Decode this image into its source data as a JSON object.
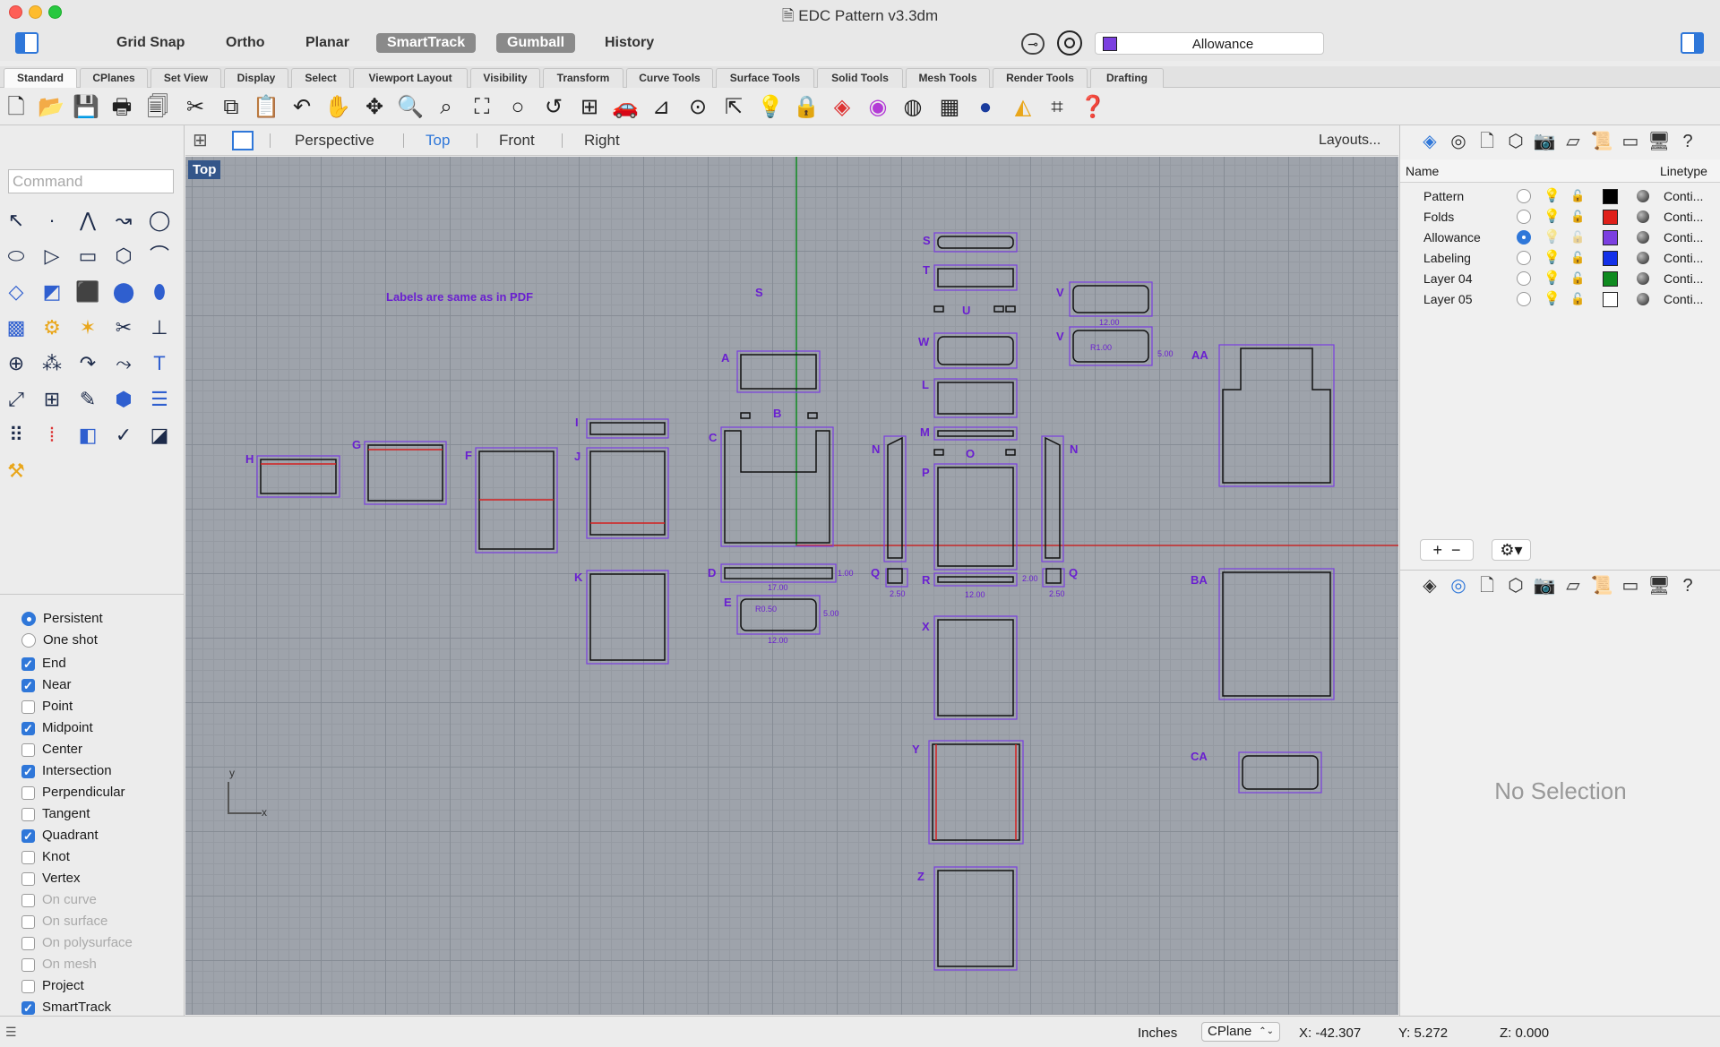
{
  "window": {
    "title": "EDC Pattern v3.3dm"
  },
  "toolbar": {
    "grid_snap": "Grid Snap",
    "ortho": "Ortho",
    "planar": "Planar",
    "smarttrack": "SmartTrack",
    "gumball": "Gumball",
    "history": "History",
    "current_layer": "Allowance",
    "current_layer_color": "#7b3fe0"
  },
  "tabs": [
    "Standard",
    "CPlanes",
    "Set View",
    "Display",
    "Select",
    "Viewport Layout",
    "Visibility",
    "Transform",
    "Curve Tools",
    "Surface Tools",
    "Solid Tools",
    "Mesh Tools",
    "Render Tools",
    "Drafting"
  ],
  "command": {
    "placeholder": "Command"
  },
  "osnap": {
    "modes": [
      "Persistent",
      "One shot"
    ],
    "snaps": [
      {
        "label": "End",
        "checked": true
      },
      {
        "label": "Near",
        "checked": true
      },
      {
        "label": "Point",
        "checked": false
      },
      {
        "label": "Midpoint",
        "checked": true
      },
      {
        "label": "Center",
        "checked": false
      },
      {
        "label": "Intersection",
        "checked": true
      },
      {
        "label": "Perpendicular",
        "checked": false
      },
      {
        "label": "Tangent",
        "checked": false
      },
      {
        "label": "Quadrant",
        "checked": true
      },
      {
        "label": "Knot",
        "checked": false
      },
      {
        "label": "Vertex",
        "checked": false
      },
      {
        "label": "On curve",
        "checked": false,
        "disabled": true
      },
      {
        "label": "On surface",
        "checked": false,
        "disabled": true
      },
      {
        "label": "On polysurface",
        "checked": false,
        "disabled": true
      },
      {
        "label": "On mesh",
        "checked": false,
        "disabled": true
      },
      {
        "label": "Project",
        "checked": false
      },
      {
        "label": "SmartTrack",
        "checked": true
      }
    ]
  },
  "viewtabs": {
    "perspective": "Perspective",
    "top": "Top",
    "front": "Front",
    "right": "Right",
    "layouts": "Layouts..."
  },
  "viewport": {
    "label": "Top",
    "note": "Labels are same as in PDF",
    "axis_x": "x",
    "axis_y": "y",
    "piece_labels": [
      "S",
      "T",
      "U",
      "V",
      "V",
      "W",
      "A",
      "B",
      "L",
      "M",
      "C",
      "N",
      "N",
      "O",
      "P",
      "H",
      "G",
      "F",
      "I",
      "J",
      "K",
      "D",
      "E",
      "Q",
      "Q",
      "R",
      "X",
      "Y",
      "Z",
      "AA",
      "BA",
      "CA"
    ],
    "dims": [
      "12.00",
      "R1.00",
      "5.00",
      "17.00",
      "R0.50",
      "12.00",
      "5.00",
      "2.50",
      "2.50",
      "12.00",
      "1.00",
      "2.00",
      "2.00"
    ]
  },
  "layers": {
    "header_name": "Name",
    "header_linetype": "Linetype",
    "rows": [
      {
        "name": "Pattern",
        "color": "#000000",
        "current": false,
        "linetype": "Conti..."
      },
      {
        "name": "Folds",
        "color": "#e0201a",
        "current": false,
        "linetype": "Conti..."
      },
      {
        "name": "Allowance",
        "color": "#7b3fe0",
        "current": true,
        "linetype": "Conti..."
      },
      {
        "name": "Labeling",
        "color": "#1330e8",
        "current": false,
        "linetype": "Conti..."
      },
      {
        "name": "Layer 04",
        "color": "#0f8a1f",
        "current": false,
        "linetype": "Conti..."
      },
      {
        "name": "Layer 05",
        "color": "#ffffff",
        "current": false,
        "linetype": "Conti..."
      }
    ]
  },
  "properties": {
    "empty": "No Selection"
  },
  "status": {
    "units": "Inches",
    "cplane": "CPlane",
    "x": "X: -42.307",
    "y": "Y: 5.272",
    "z": "Z: 0.000"
  }
}
